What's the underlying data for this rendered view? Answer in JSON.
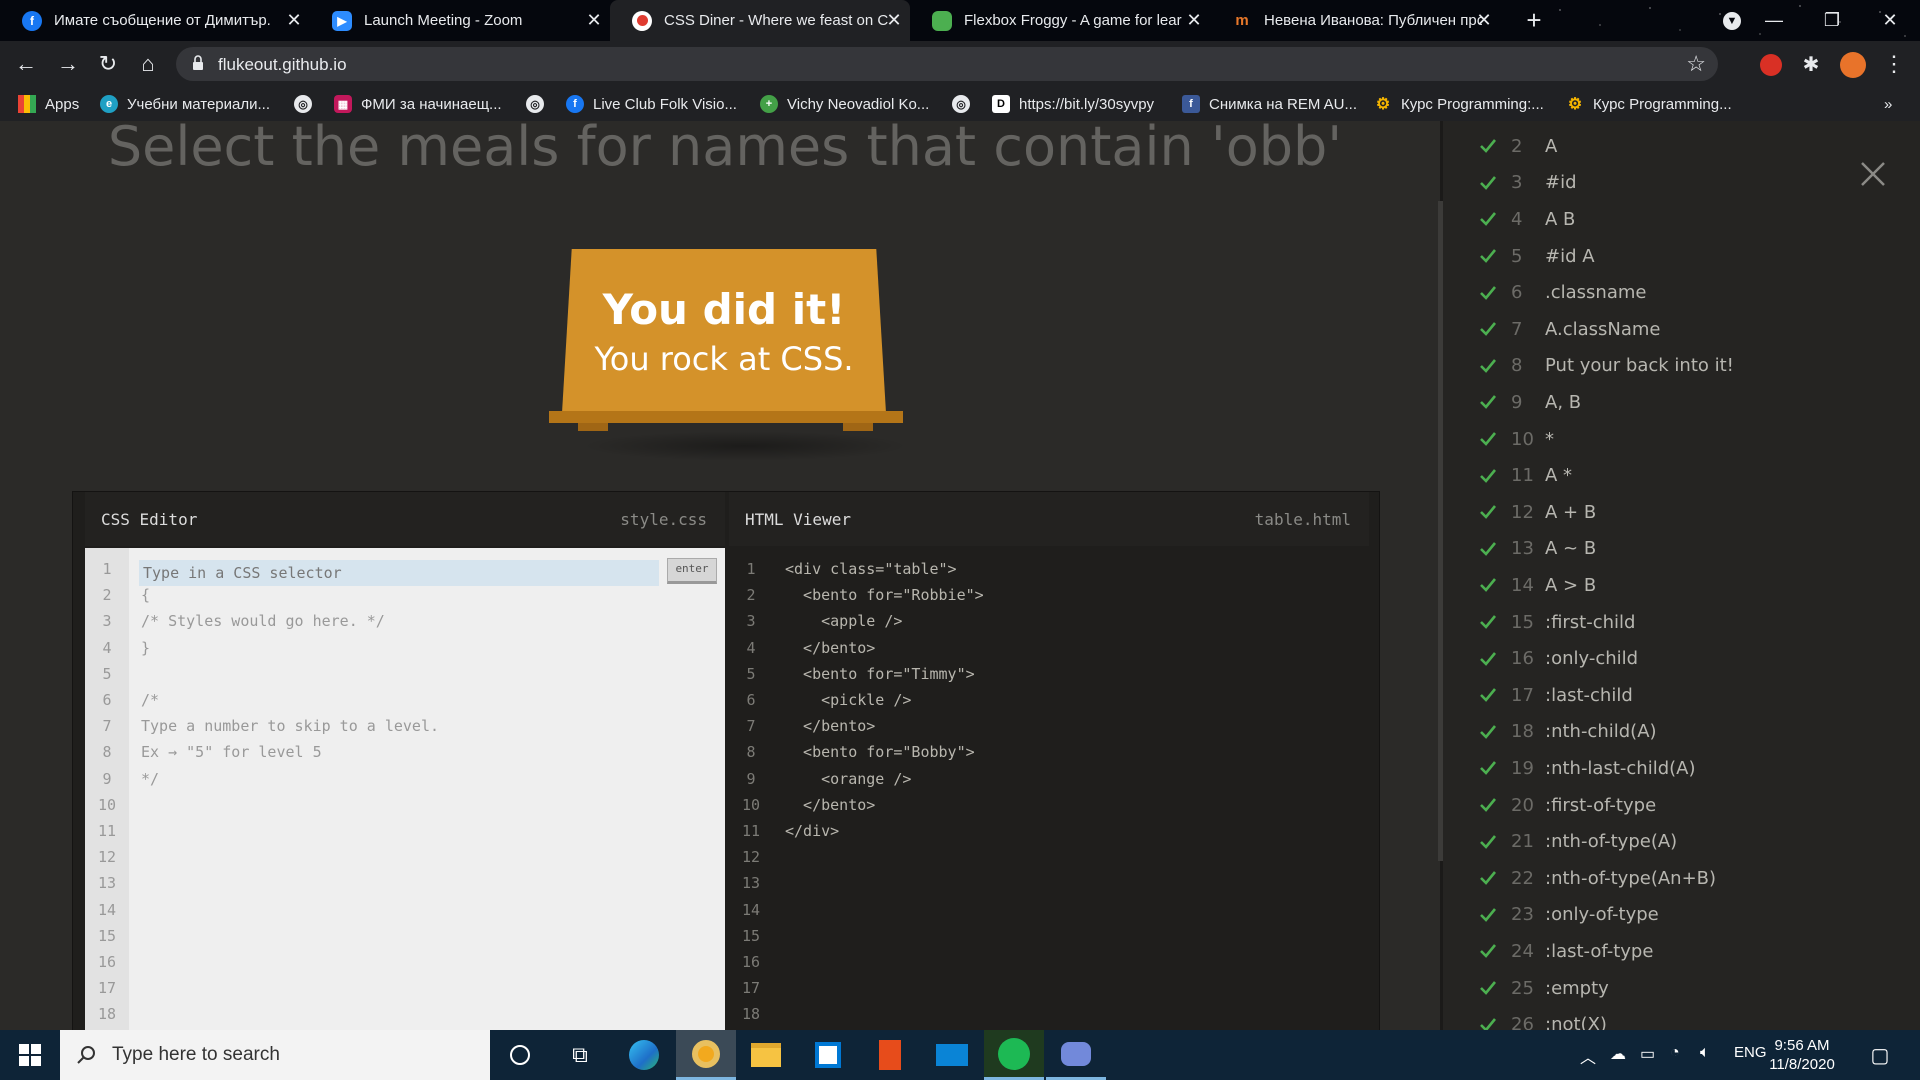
{
  "browser": {
    "tabs": [
      {
        "title": "Имате съобщение от Димитър.",
        "icon": "facebook-icon",
        "color": "#1877f2"
      },
      {
        "title": "Launch Meeting - Zoom",
        "icon": "zoom-icon",
        "color": "#2d8cff"
      },
      {
        "title": "CSS Diner - Where we feast on C",
        "icon": "css-diner-icon",
        "color": "#e03c31"
      },
      {
        "title": "Flexbox Froggy - A game for lear",
        "icon": "frog-icon",
        "color": "#4caf50"
      },
      {
        "title": "Невена Иванова: Публичен про",
        "icon": "pinterest-like-icon",
        "color": "#e8782a"
      }
    ],
    "url": "flukeout.github.io",
    "bookmarks": [
      {
        "label": "Apps",
        "icon": "apps-grid-icon"
      },
      {
        "label": "Учебни материали...",
        "icon": "edu-icon"
      },
      {
        "label": "",
        "icon": "globe-icon"
      },
      {
        "label": "ФМИ за начинаещ...",
        "icon": "fmi-icon"
      },
      {
        "label": "",
        "icon": "globe-icon"
      },
      {
        "label": "Live Club Folk Visio...",
        "icon": "facebook-icon"
      },
      {
        "label": "Vichy Neovadiol Ko...",
        "icon": "cross-icon"
      },
      {
        "label": "",
        "icon": "globe-icon"
      },
      {
        "label": "https://bit.ly/30syvpy",
        "icon": "d-icon"
      },
      {
        "label": "Снимка на REM AU...",
        "icon": "facebook-icon"
      },
      {
        "label": "Курс Programming:...",
        "icon": "gear-badge-icon"
      },
      {
        "label": "Курс Programming...",
        "icon": "gear-badge-icon"
      }
    ],
    "more_bookmarks": "»"
  },
  "game": {
    "instructions": "Select the meals for names that contain 'obb'",
    "win_title": "You did it!",
    "win_subtitle": "You rock at CSS."
  },
  "css_editor": {
    "title": "CSS Editor",
    "filename": "style.css",
    "placeholder": "Type in a CSS selector",
    "enter_label": "enter",
    "line_numbers": "1\n2\n3\n4\n5\n6\n7\n8\n9\n10\n11\n12\n13\n14\n15\n16\n17\n18",
    "code": "\n{\n/* Styles would go here. */\n}\n\n/*\nType a number to skip to a level.\nEx → \"5\" for level 5\n*/"
  },
  "html_viewer": {
    "title": "HTML Viewer",
    "filename": "table.html",
    "line_numbers": "1\n2\n3\n4\n5\n6\n7\n8\n9\n10\n11\n12\n13\n14\n15\n16\n17\n18",
    "code": "<div class=\"table\">\n  <bento for=\"Robbie\">\n    <apple />\n  </bento>\n  <bento for=\"Timmy\">\n    <pickle />\n  </bento>\n  <bento for=\"Bobby\">\n    <orange />\n  </bento>\n</div>"
  },
  "levels": [
    {
      "num": "2",
      "sel": "A"
    },
    {
      "num": "3",
      "sel": "#id"
    },
    {
      "num": "4",
      "sel": "A  B"
    },
    {
      "num": "5",
      "sel": "#id  A"
    },
    {
      "num": "6",
      "sel": ".classname"
    },
    {
      "num": "7",
      "sel": "A.className"
    },
    {
      "num": "8",
      "sel": "Put your back into it!"
    },
    {
      "num": "9",
      "sel": "A, B"
    },
    {
      "num": "10",
      "sel": "*"
    },
    {
      "num": "11",
      "sel": "A  *"
    },
    {
      "num": "12",
      "sel": "A + B"
    },
    {
      "num": "13",
      "sel": "A ~ B"
    },
    {
      "num": "14",
      "sel": "A > B"
    },
    {
      "num": "15",
      "sel": ":first-child"
    },
    {
      "num": "16",
      "sel": ":only-child"
    },
    {
      "num": "17",
      "sel": ":last-child"
    },
    {
      "num": "18",
      "sel": ":nth-child(A)"
    },
    {
      "num": "19",
      "sel": ":nth-last-child(A)"
    },
    {
      "num": "20",
      "sel": ":first-of-type"
    },
    {
      "num": "21",
      "sel": ":nth-of-type(A)"
    },
    {
      "num": "22",
      "sel": ":nth-of-type(An+B)"
    },
    {
      "num": "23",
      "sel": ":only-of-type"
    },
    {
      "num": "24",
      "sel": ":last-of-type"
    },
    {
      "num": "25",
      "sel": ":empty"
    },
    {
      "num": "26",
      "sel": ":not(X)"
    }
  ],
  "taskbar": {
    "search_placeholder": "Type here to search",
    "language": "ENG",
    "time": "9:56 AM",
    "date": "11/8/2020"
  },
  "colors": {
    "accent": "#d4922a",
    "check": "#4caf50"
  }
}
